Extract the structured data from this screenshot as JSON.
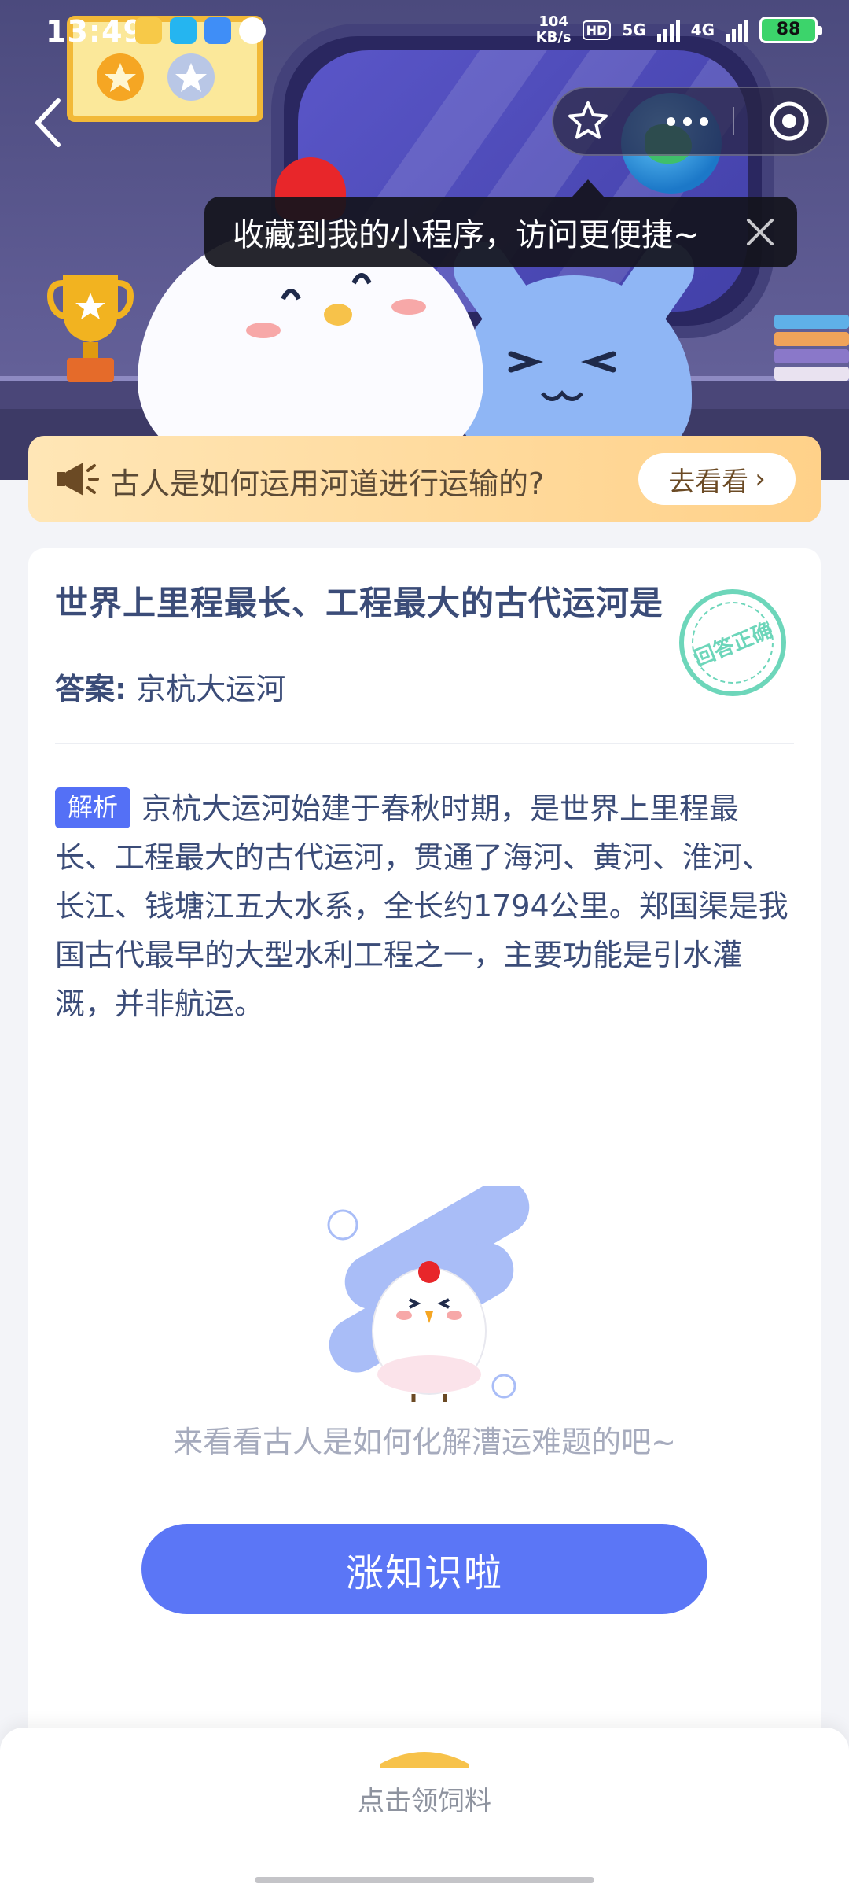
{
  "status_bar": {
    "time": "13:49",
    "net_speed_value": "104",
    "net_speed_unit": "KB/s",
    "hd": "HD",
    "signal_1": "5G",
    "signal_2": "4G",
    "battery": "88"
  },
  "tooltip": {
    "text": "收藏到我的小程序，访问更便捷~"
  },
  "banner": {
    "text": "古人是如何运用河道进行运输的?",
    "button_label": "去看看",
    "button_chevron": "›"
  },
  "card": {
    "question": "世界上里程最长、工程最大的古代运河是",
    "answer_label": "答案:",
    "answer_value": "京杭大运河",
    "stamp_text": "回答正确",
    "analysis_tag": "解析",
    "analysis_text": "京杭大运河始建于春秋时期，是世界上里程最长、工程最大的古代运河，贯通了海河、黄河、淮河、长江、钱塘江五大水系，全长约1794公里。郑国渠是我国古代最早的大型水利工程之一，主要功能是引水灌溉，并非航运。",
    "hint": "来看看古人是如何化解漕运难题的吧~",
    "cta_label": "涨知识啦"
  },
  "drawer": {
    "label": "点击领饲料"
  },
  "colors": {
    "accent_blue": "#5b76f6",
    "tag_blue": "#5470f6",
    "stamp_green": "#5ed2b3",
    "banner_orange": "#ffd189",
    "title_navy": "#3b4c78"
  },
  "icons": [
    "back-arrow-icon",
    "star-icon",
    "more-dots-icon",
    "target-icon",
    "close-icon",
    "megaphone-icon",
    "chevron-right-icon",
    "feed-bowl-icon"
  ]
}
